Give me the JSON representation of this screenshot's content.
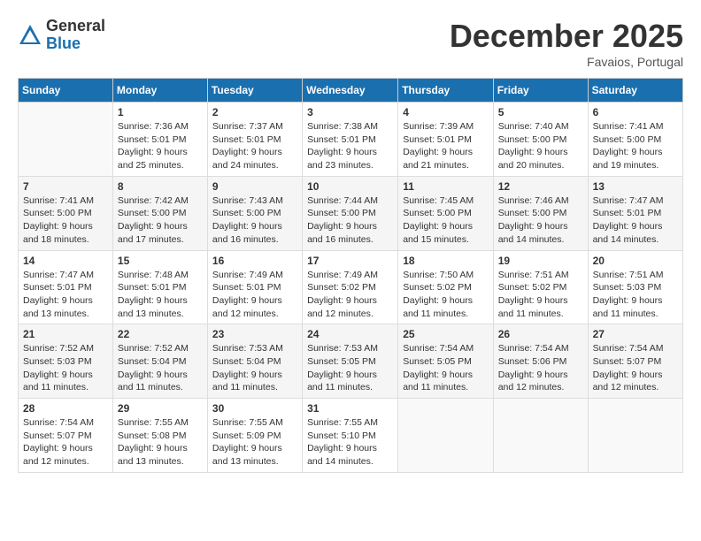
{
  "header": {
    "logo_general": "General",
    "logo_blue": "Blue",
    "month_title": "December 2025",
    "subtitle": "Favaios, Portugal"
  },
  "days_of_week": [
    "Sunday",
    "Monday",
    "Tuesday",
    "Wednesday",
    "Thursday",
    "Friday",
    "Saturday"
  ],
  "weeks": [
    [
      {
        "day": "",
        "info": ""
      },
      {
        "day": "1",
        "info": "Sunrise: 7:36 AM\nSunset: 5:01 PM\nDaylight: 9 hours\nand 25 minutes."
      },
      {
        "day": "2",
        "info": "Sunrise: 7:37 AM\nSunset: 5:01 PM\nDaylight: 9 hours\nand 24 minutes."
      },
      {
        "day": "3",
        "info": "Sunrise: 7:38 AM\nSunset: 5:01 PM\nDaylight: 9 hours\nand 23 minutes."
      },
      {
        "day": "4",
        "info": "Sunrise: 7:39 AM\nSunset: 5:01 PM\nDaylight: 9 hours\nand 21 minutes."
      },
      {
        "day": "5",
        "info": "Sunrise: 7:40 AM\nSunset: 5:00 PM\nDaylight: 9 hours\nand 20 minutes."
      },
      {
        "day": "6",
        "info": "Sunrise: 7:41 AM\nSunset: 5:00 PM\nDaylight: 9 hours\nand 19 minutes."
      }
    ],
    [
      {
        "day": "7",
        "info": "Sunrise: 7:41 AM\nSunset: 5:00 PM\nDaylight: 9 hours\nand 18 minutes."
      },
      {
        "day": "8",
        "info": "Sunrise: 7:42 AM\nSunset: 5:00 PM\nDaylight: 9 hours\nand 17 minutes."
      },
      {
        "day": "9",
        "info": "Sunrise: 7:43 AM\nSunset: 5:00 PM\nDaylight: 9 hours\nand 16 minutes."
      },
      {
        "day": "10",
        "info": "Sunrise: 7:44 AM\nSunset: 5:00 PM\nDaylight: 9 hours\nand 16 minutes."
      },
      {
        "day": "11",
        "info": "Sunrise: 7:45 AM\nSunset: 5:00 PM\nDaylight: 9 hours\nand 15 minutes."
      },
      {
        "day": "12",
        "info": "Sunrise: 7:46 AM\nSunset: 5:00 PM\nDaylight: 9 hours\nand 14 minutes."
      },
      {
        "day": "13",
        "info": "Sunrise: 7:47 AM\nSunset: 5:01 PM\nDaylight: 9 hours\nand 14 minutes."
      }
    ],
    [
      {
        "day": "14",
        "info": "Sunrise: 7:47 AM\nSunset: 5:01 PM\nDaylight: 9 hours\nand 13 minutes."
      },
      {
        "day": "15",
        "info": "Sunrise: 7:48 AM\nSunset: 5:01 PM\nDaylight: 9 hours\nand 13 minutes."
      },
      {
        "day": "16",
        "info": "Sunrise: 7:49 AM\nSunset: 5:01 PM\nDaylight: 9 hours\nand 12 minutes."
      },
      {
        "day": "17",
        "info": "Sunrise: 7:49 AM\nSunset: 5:02 PM\nDaylight: 9 hours\nand 12 minutes."
      },
      {
        "day": "18",
        "info": "Sunrise: 7:50 AM\nSunset: 5:02 PM\nDaylight: 9 hours\nand 11 minutes."
      },
      {
        "day": "19",
        "info": "Sunrise: 7:51 AM\nSunset: 5:02 PM\nDaylight: 9 hours\nand 11 minutes."
      },
      {
        "day": "20",
        "info": "Sunrise: 7:51 AM\nSunset: 5:03 PM\nDaylight: 9 hours\nand 11 minutes."
      }
    ],
    [
      {
        "day": "21",
        "info": "Sunrise: 7:52 AM\nSunset: 5:03 PM\nDaylight: 9 hours\nand 11 minutes."
      },
      {
        "day": "22",
        "info": "Sunrise: 7:52 AM\nSunset: 5:04 PM\nDaylight: 9 hours\nand 11 minutes."
      },
      {
        "day": "23",
        "info": "Sunrise: 7:53 AM\nSunset: 5:04 PM\nDaylight: 9 hours\nand 11 minutes."
      },
      {
        "day": "24",
        "info": "Sunrise: 7:53 AM\nSunset: 5:05 PM\nDaylight: 9 hours\nand 11 minutes."
      },
      {
        "day": "25",
        "info": "Sunrise: 7:54 AM\nSunset: 5:05 PM\nDaylight: 9 hours\nand 11 minutes."
      },
      {
        "day": "26",
        "info": "Sunrise: 7:54 AM\nSunset: 5:06 PM\nDaylight: 9 hours\nand 12 minutes."
      },
      {
        "day": "27",
        "info": "Sunrise: 7:54 AM\nSunset: 5:07 PM\nDaylight: 9 hours\nand 12 minutes."
      }
    ],
    [
      {
        "day": "28",
        "info": "Sunrise: 7:54 AM\nSunset: 5:07 PM\nDaylight: 9 hours\nand 12 minutes."
      },
      {
        "day": "29",
        "info": "Sunrise: 7:55 AM\nSunset: 5:08 PM\nDaylight: 9 hours\nand 13 minutes."
      },
      {
        "day": "30",
        "info": "Sunrise: 7:55 AM\nSunset: 5:09 PM\nDaylight: 9 hours\nand 13 minutes."
      },
      {
        "day": "31",
        "info": "Sunrise: 7:55 AM\nSunset: 5:10 PM\nDaylight: 9 hours\nand 14 minutes."
      },
      {
        "day": "",
        "info": ""
      },
      {
        "day": "",
        "info": ""
      },
      {
        "day": "",
        "info": ""
      }
    ]
  ]
}
